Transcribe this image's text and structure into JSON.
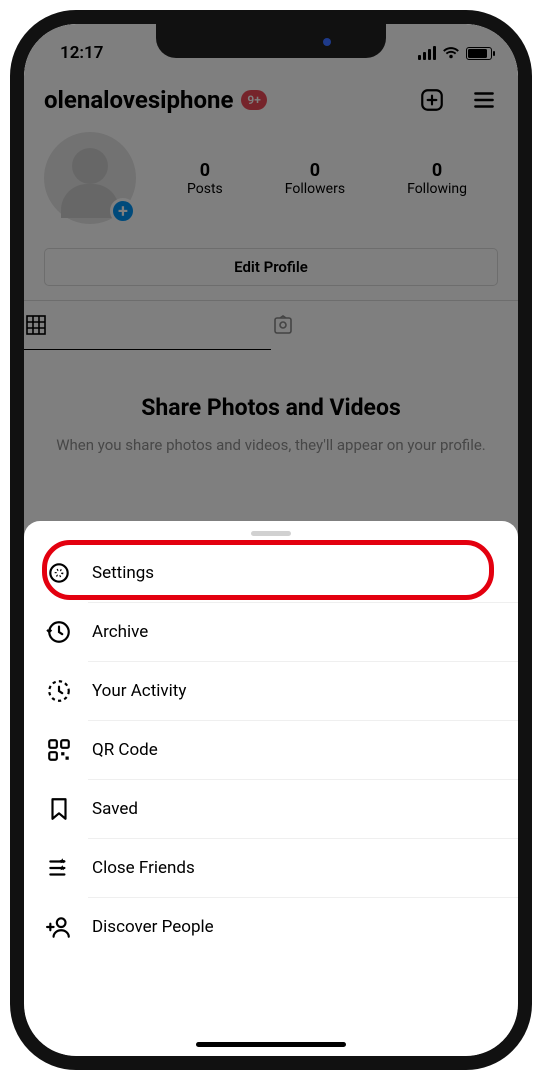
{
  "status": {
    "time": "12:17"
  },
  "header": {
    "username": "olenalovesiphone",
    "badge": "9+"
  },
  "stats": {
    "posts": {
      "count": "0",
      "label": "Posts"
    },
    "followers": {
      "count": "0",
      "label": "Followers"
    },
    "following": {
      "count": "0",
      "label": "Following"
    }
  },
  "buttons": {
    "edit_profile": "Edit Profile"
  },
  "avatar_plus": "+",
  "empty": {
    "title": "Share Photos and Videos",
    "subtitle": "When you share photos and videos, they'll appear on your profile."
  },
  "menu": {
    "settings": "Settings",
    "archive": "Archive",
    "activity": "Your Activity",
    "qr": "QR Code",
    "saved": "Saved",
    "close_friends": "Close Friends",
    "discover": "Discover People"
  }
}
